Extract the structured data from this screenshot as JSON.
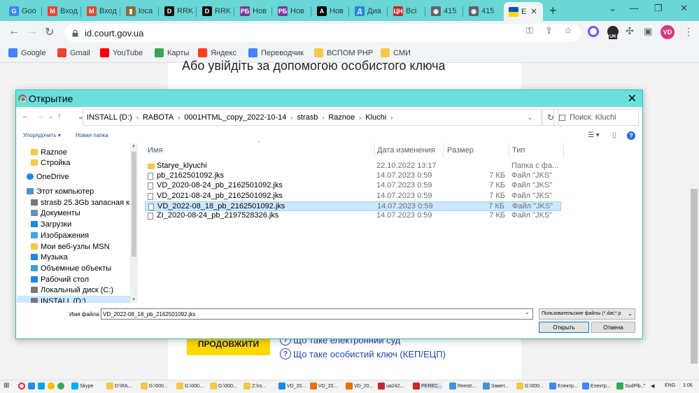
{
  "browser": {
    "tabs": [
      {
        "label": "Goo",
        "color": "#4285f4",
        "glyph": "G"
      },
      {
        "label": "Вход",
        "color": "#ea4335",
        "glyph": "M"
      },
      {
        "label": "Вход",
        "color": "#ea4335",
        "glyph": "M"
      },
      {
        "label": "loca",
        "color": "#8a6d3b",
        "glyph": "▮"
      },
      {
        "label": "RRK",
        "color": "#111111",
        "glyph": "D"
      },
      {
        "label": "RRK",
        "color": "#111111",
        "glyph": "D"
      },
      {
        "label": "Нов",
        "color": "#7b3a96",
        "glyph": "РБ"
      },
      {
        "label": "Нов",
        "color": "#7b3a96",
        "glyph": "РБ"
      },
      {
        "label": "Нов",
        "color": "#000000",
        "glyph": "A"
      },
      {
        "label": "Диа",
        "color": "#1e88e5",
        "glyph": "Д"
      },
      {
        "label": "Всі",
        "color": "#c62828",
        "glyph": "ЦН"
      },
      {
        "label": "415",
        "color": "#5f6368",
        "glyph": "◉"
      },
      {
        "label": "415",
        "color": "#5f6368",
        "glyph": "◉"
      },
      {
        "label": "Е",
        "color": "#0057b7",
        "glyph": "",
        "active": true
      }
    ],
    "url": "id.court.gov.ua",
    "profile_initials": "VD",
    "extension_badge": "UK",
    "bookmarks": [
      {
        "label": "Google",
        "color": "#4285f4"
      },
      {
        "label": "Gmail",
        "color": "#ea4335"
      },
      {
        "label": "YouTube",
        "color": "#ff0000"
      },
      {
        "label": "Карты",
        "color": "#34a853"
      },
      {
        "label": "Яндекс",
        "color": "#fc3f1d"
      },
      {
        "label": "Переводчик",
        "color": "#4285f4"
      },
      {
        "label": "ВСПОМ PHP",
        "color": "#f4c84a"
      },
      {
        "label": "СМИ",
        "color": "#f4c84a"
      }
    ]
  },
  "page": {
    "heading": "Або увійдіть за допомогою особистого ключа",
    "continue_button": "ПРОДОВЖИТИ",
    "links": [
      "Що таке електронний суд",
      "Що таке особистий ключ (КЕП/ЕЦП)"
    ]
  },
  "dialog": {
    "title": "Открытие",
    "breadcrumbs": [
      "INSTALL (D:)",
      "RABOTA",
      "0001HTML_copy_2022-10-14",
      "strasb",
      "Raznoe",
      "Kluchi"
    ],
    "search_placeholder": "Поиск: Kluchi",
    "organize_label": "Упорядочить ▾",
    "new_folder_label": "Новая папка",
    "nav_items": [
      {
        "label": "Raznoe",
        "icon": "folder-icon",
        "color": "#f4c84a",
        "indent": 2
      },
      {
        "label": "Стройка",
        "icon": "folder-icon",
        "color": "#f4c84a",
        "indent": 2
      },
      {
        "label": "OneDrive",
        "icon": "cloud-icon",
        "color": "#1e88e5",
        "indent": 1
      },
      {
        "label": "Этот компьютер",
        "icon": "computer-icon",
        "color": "#4a90d9",
        "indent": 1
      },
      {
        "label": "strasb 25.3Gb запасная к",
        "icon": "drive-icon",
        "color": "#777777",
        "indent": 2
      },
      {
        "label": "Документы",
        "icon": "documents-icon",
        "color": "#6b8fb8",
        "indent": 2
      },
      {
        "label": "Загрузки",
        "icon": "downloads-icon",
        "color": "#1e88e5",
        "indent": 2
      },
      {
        "label": "Изображения",
        "icon": "pictures-icon",
        "color": "#4aa3df",
        "indent": 2
      },
      {
        "label": "Мои веб-узлы MSN",
        "icon": "folder-icon",
        "color": "#f4c84a",
        "indent": 2
      },
      {
        "label": "Музыка",
        "icon": "music-icon",
        "color": "#1e88e5",
        "indent": 2
      },
      {
        "label": "Объемные объекты",
        "icon": "objects-icon",
        "color": "#3aa0d8",
        "indent": 2
      },
      {
        "label": "Рабочий стол",
        "icon": "desktop-icon",
        "color": "#1e88e5",
        "indent": 2
      },
      {
        "label": "Локальный диск (C:)",
        "icon": "drive-icon",
        "color": "#777777",
        "indent": 2
      },
      {
        "label": "INSTALL (D:)",
        "icon": "drive-icon",
        "color": "#777777",
        "indent": 2,
        "selected": true
      }
    ],
    "columns": {
      "name": "Имя",
      "date": "Дата изменения",
      "size": "Размер",
      "type": "Тип"
    },
    "files": [
      {
        "name": "Starye_klyuchi",
        "date": "22.10.2022 13:17",
        "size": "",
        "type": "Папка с фа...",
        "folder": true
      },
      {
        "name": "pb_2162501092.jks",
        "date": "14.07.2023 0:59",
        "size": "7 КБ",
        "type": "Файл \"JKS\""
      },
      {
        "name": "VD_2020-08-24_pb_2162501092.jks",
        "date": "14.07.2023 0:59",
        "size": "7 КБ",
        "type": "Файл \"JKS\""
      },
      {
        "name": "VD_2021-08-24_pb_2162501092.jks",
        "date": "14.07.2023 0:59",
        "size": "7 КБ",
        "type": "Файл \"JKS\""
      },
      {
        "name": "VD_2022-08_18_pb_2162501092.jks",
        "date": "14.07.2023 0:59",
        "size": "7 КБ",
        "type": "Файл \"JKS\"",
        "selected": true
      },
      {
        "name": "ZI_2020-08-24_pb_2197528326.jks",
        "date": "14.07.2023 0:59",
        "size": "7 КБ",
        "type": "Файл \"JKS\""
      }
    ],
    "filename_label": "Имя файла:",
    "filename_value": "VD_2022-08_18_pb_2162501092.jks",
    "filter_value": "Пользовательские файлы (*.dat;*.p",
    "open_button": "Открыть",
    "cancel_button": "Отмена"
  },
  "taskbar": {
    "items": [
      {
        "label": "Skype",
        "color": "#00aff0"
      },
      {
        "label": "D:\\RA...",
        "color": "#f4c84a"
      },
      {
        "label": "G:\\000...",
        "color": "#f4c84a"
      },
      {
        "label": "G:\\000...",
        "color": "#f4c84a"
      },
      {
        "label": "G:\\000...",
        "color": "#f4c84a"
      },
      {
        "label": "Z:\\ro...",
        "color": "#f4c84a"
      },
      {
        "label": "VD_20...",
        "color": "#1e88e5"
      },
      {
        "label": "VD_20...",
        "color": "#e8710a"
      },
      {
        "label": "VD_20...",
        "color": "#e8710a"
      },
      {
        "label": "ua242...",
        "color": "#c62828"
      },
      {
        "label": "PЕRЕС...",
        "color": "#c62828"
      },
      {
        "label": "Reestr...",
        "color": "#4a90d9"
      },
      {
        "label": "Замет...",
        "color": "#4a90d9"
      },
      {
        "label": "G:\\000...",
        "color": "#f4c84a"
      },
      {
        "label": "Електр...",
        "color": "#4285f4"
      },
      {
        "label": "Електр...",
        "color": "#4285f4"
      },
      {
        "label": "SudPlb...",
        "color": "#34a853"
      }
    ],
    "language": "ENG",
    "time": "1:06"
  }
}
